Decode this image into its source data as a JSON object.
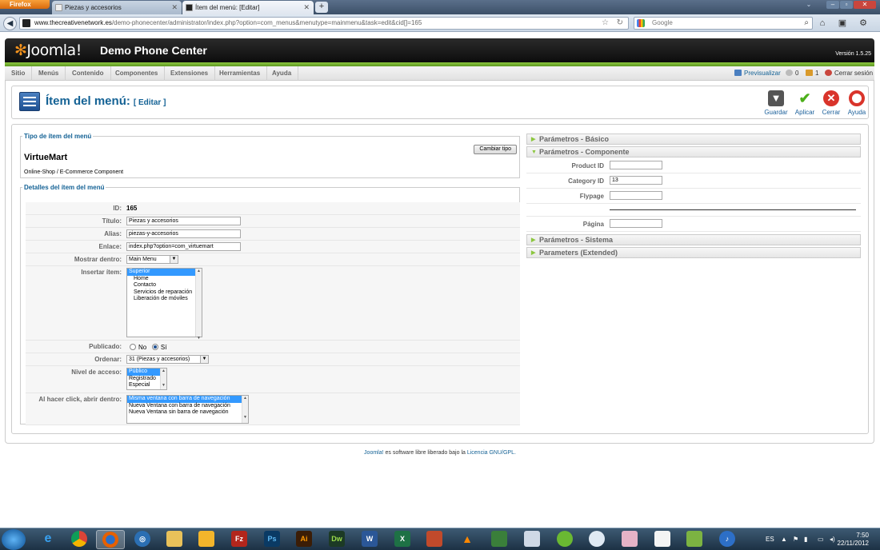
{
  "browser": {
    "menu_button": "Firefox",
    "tabs": [
      {
        "label": "Piezas y accesorios",
        "active": false
      },
      {
        "label": "Ítem del menú: [Editar]",
        "active": true
      }
    ],
    "url_domain": "www.thecreativenetwork.es",
    "url_rest": "/demo-phonecenter/administrator/index.php?option=com_menus&menutype=mainmenu&task=edit&cid[]=165",
    "search_placeholder": "Google"
  },
  "header": {
    "logo": "Joomla!",
    "site_name": "Demo Phone Center",
    "version": "Versión 1.5.25"
  },
  "menubar": {
    "items": [
      "Sitio",
      "Menús",
      "Contenido",
      "Componentes",
      "Extensiones",
      "Herramientas",
      "Ayuda"
    ],
    "preview": "Previsualizar",
    "messages": "0",
    "users": "1",
    "logout": "Cerrar sesión"
  },
  "toolbar": {
    "title": "Ítem del menú:",
    "subtitle": "[ Editar ]",
    "buttons": [
      "Guardar",
      "Aplicar",
      "Cerrar",
      "Ayuda"
    ]
  },
  "type_box": {
    "legend": "Tipo de ítem del menú",
    "name": "VirtueMart",
    "description": "Online-Shop / E-Commerce Component",
    "change_button": "Cambiar tipo"
  },
  "details": {
    "legend": "Detalles del ítem del menú",
    "id_label": "ID:",
    "id_value": "165",
    "title_label": "Título:",
    "title_value": "Piezas y accesorios",
    "alias_label": "Alias:",
    "alias_value": "piezas-y-accesorios",
    "link_label": "Enlace:",
    "link_value": "index.php?option=com_virtuemart",
    "show_in_label": "Mostrar dentro:",
    "show_in_value": "Main Menu",
    "insert_label": "Insertar ítem:",
    "insert_options": [
      "Superior",
      "Home",
      "Contacto",
      "Servicios de reparación",
      "Liberación de móviles"
    ],
    "published_label": "Publicado:",
    "published_no": "No",
    "published_yes": "Sí",
    "order_label": "Ordenar:",
    "order_value": "31 (Piezas y accesorios)",
    "access_label": "Nivel de acceso:",
    "access_options": [
      "Público",
      "Registrado",
      "Especial"
    ],
    "click_label": "Al hacer click, abrir dentro:",
    "click_options": [
      "Misma ventana con barra de navegación",
      "Nueva Ventana con barra de navegación",
      "Nueva Ventana sin barra de navegación"
    ]
  },
  "params": {
    "basic": "Parámetros - Básico",
    "component": "Parámetros - Componente",
    "product_id_label": "Product ID",
    "product_id_value": "",
    "category_id_label": "Category ID",
    "category_id_value": "13",
    "flypage_label": "Flypage",
    "flypage_value": "",
    "page_label": "Página",
    "page_value": "",
    "system": "Parámetros - Sistema",
    "extended": "Parameters (Extended)"
  },
  "footer": {
    "link1": "Joomla!",
    "text": " es software libre liberado bajo la ",
    "link2": "Licencia GNU/GPL."
  },
  "taskbar": {
    "language": "ES",
    "time": "7:50",
    "date": "22/11/2012"
  }
}
